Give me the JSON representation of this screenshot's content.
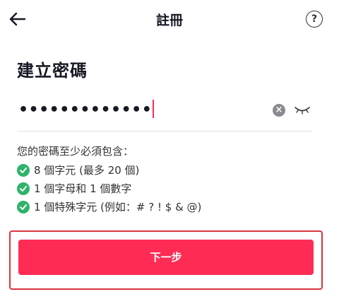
{
  "header": {
    "title": "註冊",
    "back_icon": "arrow-left-icon",
    "help_label": "?"
  },
  "main": {
    "heading": "建立密碼",
    "password": {
      "masked_value": "•••••••••••••",
      "clear_icon": "clear-icon",
      "visibility_icon": "eye-closed-icon"
    },
    "requirements_title": "您的密碼至少必須包含：",
    "requirements": [
      {
        "text": "8 個字元 (最多 20 個)",
        "met": true
      },
      {
        "text": "1 個字母和 1 個數字",
        "met": true
      },
      {
        "text": "1 個特殊字元 (例如：# ? ! $ & @)",
        "met": true
      }
    ],
    "next_button": "下一步"
  },
  "colors": {
    "accent": "#fe2c55",
    "check": "#2fb36a",
    "highlight_frame": "#d8343b"
  }
}
